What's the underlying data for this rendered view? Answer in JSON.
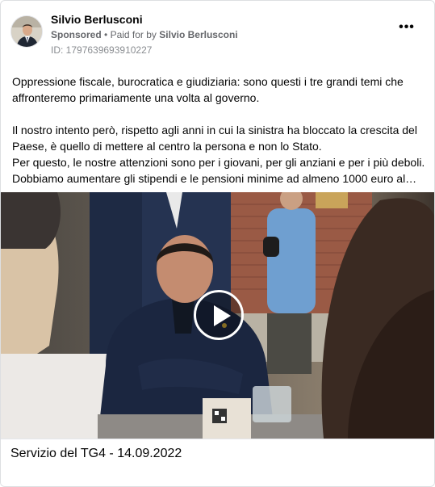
{
  "ad": {
    "page_name": "Silvio Berlusconi",
    "sponsored_label": "Sponsored",
    "separator": "•",
    "paid_for_prefix": "Paid for by",
    "paid_for_by": "Silvio Berlusconi",
    "library_id": "ID: 1797639693910227",
    "more_options_icon": "ellipsis-horizontal-icon"
  },
  "post": {
    "paragraph_1": "Oppressione fiscale, burocratica e giudiziaria: sono questi i tre grandi temi che affronteremo primariamente una volta al governo.",
    "paragraph_2": "Il nostro intento però, rispetto agli anni in cui la sinistra ha bloccato la crescita del Paese, è quello di mettere al centro la persona e non lo Stato.",
    "paragraph_3": "Per questo, le nostre attenzioni sono per i giovani, per gli anziani e per i più deboli.",
    "paragraph_4": "Dobbiamo aumentare gli stipendi e le pensioni minime ad almeno 1000 euro al…"
  },
  "media": {
    "type": "video",
    "play_icon": "play-icon",
    "caption": "Servizio del TG4 - 14.09.2022"
  }
}
